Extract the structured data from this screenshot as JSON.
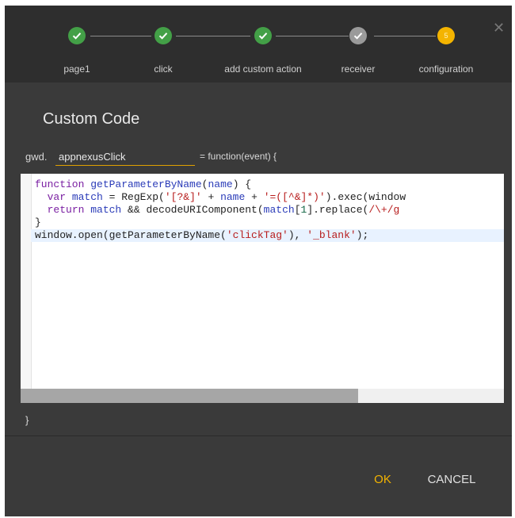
{
  "stepper": {
    "steps": [
      {
        "label": "page1",
        "state": "done"
      },
      {
        "label": "click",
        "state": "done"
      },
      {
        "label": "add custom action",
        "state": "done"
      },
      {
        "label": "receiver",
        "state": "done-gray"
      },
      {
        "label": "configuration",
        "state": "active",
        "number": "5"
      }
    ]
  },
  "dialog": {
    "title": "Custom Code",
    "close_icon": "close-icon"
  },
  "function_header": {
    "prefix": "gwd.",
    "name_value": "appnexusClick",
    "suffix": "= function(event) {",
    "closing": "}"
  },
  "editor": {
    "lines": [
      [
        {
          "t": "function ",
          "c": "kw"
        },
        {
          "t": "getParameterByName",
          "c": "def"
        },
        {
          "t": "(",
          "c": ""
        },
        {
          "t": "name",
          "c": "def"
        },
        {
          "t": ") {",
          "c": ""
        }
      ],
      [
        {
          "t": "  ",
          "c": ""
        },
        {
          "t": "var ",
          "c": "kw"
        },
        {
          "t": "match",
          "c": "def"
        },
        {
          "t": " = RegExp(",
          "c": ""
        },
        {
          "t": "'[?&]'",
          "c": "str"
        },
        {
          "t": " + ",
          "c": ""
        },
        {
          "t": "name",
          "c": "def"
        },
        {
          "t": " + ",
          "c": ""
        },
        {
          "t": "'=([^&]*)'",
          "c": "str"
        },
        {
          "t": ").exec(window",
          "c": ""
        }
      ],
      [
        {
          "t": "  ",
          "c": ""
        },
        {
          "t": "return ",
          "c": "kw"
        },
        {
          "t": "match",
          "c": "def"
        },
        {
          "t": " && decodeURIComponent(",
          "c": ""
        },
        {
          "t": "match",
          "c": "def"
        },
        {
          "t": "[",
          "c": ""
        },
        {
          "t": "1",
          "c": "num"
        },
        {
          "t": "].replace(",
          "c": ""
        },
        {
          "t": "/\\+/g",
          "c": "str"
        }
      ],
      [
        {
          "t": "}",
          "c": ""
        }
      ],
      [
        {
          "t": "window.open(getParameterByName(",
          "c": ""
        },
        {
          "t": "'clickTag'",
          "c": "str"
        },
        {
          "t": "), ",
          "c": ""
        },
        {
          "t": "'_blank'",
          "c": "str"
        },
        {
          "t": ");",
          "c": ""
        }
      ]
    ],
    "highlighted_line": 4
  },
  "buttons": {
    "ok": "OK",
    "cancel": "CANCEL"
  },
  "colors": {
    "done": "#43a047",
    "active": "#f4b400",
    "accent": "#f4b400"
  }
}
